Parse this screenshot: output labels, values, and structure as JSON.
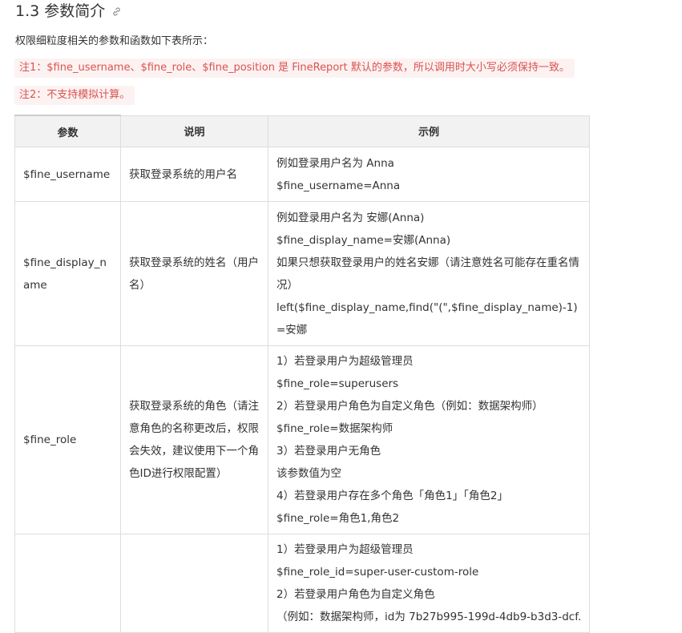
{
  "section": {
    "title": "1.3 参数简介"
  },
  "intro": "权限细粒度相关的参数和函数如下表所示：",
  "notes": [
    "注1：$fine_username、$fine_role、$fine_position 是 FineReport 默认的参数，所以调用时大小写必须保持一致。",
    "注2：不支持模拟计算。"
  ],
  "table": {
    "headers": [
      "参数",
      "说明",
      "示例"
    ],
    "rows": [
      {
        "param": "$fine_username",
        "desc": "获取登录系统的用户名",
        "example": [
          "例如登录用户名为 Anna",
          "$fine_username=Anna"
        ]
      },
      {
        "param": "$fine_display_name",
        "desc": "获取登录系统的姓名（用户名）",
        "example": [
          "例如登录用户名为 安娜(Anna)",
          "$fine_display_name=安娜(Anna)",
          "如果只想获取登录用户的姓名安娜（请注意姓名可能存在重名情况）",
          "left($fine_display_name,find(\"(\",$fine_display_name)-1)=安娜"
        ]
      },
      {
        "param": "$fine_role",
        "desc": "获取登录系统的角色（请注意角色的名称更改后，权限会失效，建议使用下一个角色ID进行权限配置）",
        "example": [
          "1）若登录用户为超级管理员",
          "$fine_role=superusers",
          "2）若登录用户角色为自定义角色（例如：数据架构师）",
          "$fine_role=数据架构师",
          "3）若登录用户无角色",
          "该参数值为空",
          "4）若登录用户存在多个角色「角色1」「角色2」",
          "$fine_role=角色1,角色2"
        ]
      },
      {
        "param": "",
        "desc": "",
        "example": [
          "1）若登录用户为超级管理员",
          "$fine_role_id=super-user-custom-role",
          "2）若登录用户角色为自定义角色",
          "（例如：数据架构师，id为 7b27b995-199d-4db9-b3d3-dcf..."
        ]
      }
    ]
  }
}
